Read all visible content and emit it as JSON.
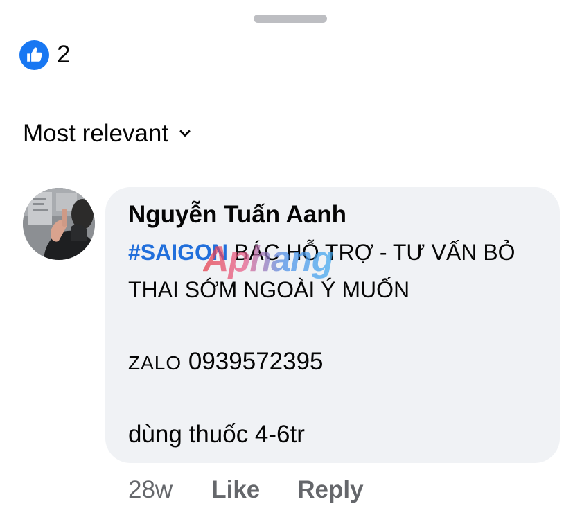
{
  "sheet": {
    "handle_icon": "drag-handle"
  },
  "reactions": {
    "icon": "thumbs-up-icon",
    "count": "2",
    "accent_color": "#1877f2"
  },
  "sort": {
    "label": "Most relevant",
    "icon": "chevron-down-icon"
  },
  "comment": {
    "author": "Nguyễn Tuấn Aanh",
    "hashtag": "#SAIGON",
    "hashtag_color": "#216fdb",
    "line1_rest": " BÁC HỖ TRỢ - TƯ VẤN BỎ",
    "line2": "THAI SỚM NGOÀI Ý MUỐN",
    "zalo_label": "ZALO",
    "zalo_number": " 0939572395",
    "line4": "dùng thuốc 4-6tr",
    "watermark": "Aphang",
    "bubble_color": "#f0f2f5"
  },
  "actions": {
    "timestamp": "28w",
    "like_label": "Like",
    "reply_label": "Reply"
  }
}
